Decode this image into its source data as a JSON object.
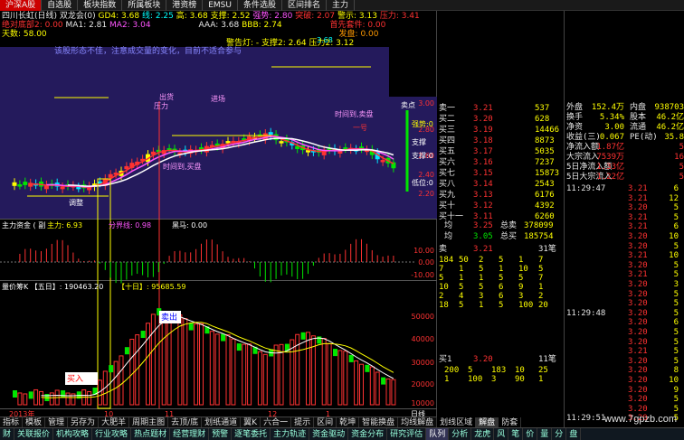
{
  "topbar": {
    "items": [
      "沪深A股",
      "自选股",
      "板块指数",
      "所属板块",
      "港资榜",
      "EMSU",
      "条件选股",
      "区间排名",
      "主力"
    ]
  },
  "chart": {
    "title": "四川长虹(日线) 双龙会(0)",
    "header_vals": [
      "GD4: 3.68",
      "线: 2.25",
      "高: 3.68",
      "支撑: 2.52",
      "强势: 2.80",
      "突破: 2.07",
      "警示: 3.13",
      "压力: 3.41",
      "压力"
    ],
    "line2_label": "绝对底部2: 0.00",
    "line2_ma": [
      "MA1: 2.81",
      "MA2: 3.04"
    ],
    "line2_extra": [
      "AAA: 3.68",
      "BBB: 2.74"
    ],
    "line2_right": "首先套件: 0.00",
    "line3": [
      "天数: 58.00",
      "发盘: 0.00"
    ],
    "line4_right": "警告灯: -  支撑2: 2.64  压力2: 3.12",
    "top_annotation": "该股形态不佳，注意成交量的变化，目前不适合参与",
    "price_high": "3.68",
    "annotations": [
      "时间到,买盘",
      "时间到,卖盘",
      "出货",
      "进场",
      "一号",
      "调整",
      "压力",
      "支撑",
      "卖点",
      "支撑:0",
      "低位:0",
      "强势:0"
    ],
    "price_axis": [
      "3.00",
      "2.80",
      "2.60",
      "2.40",
      "2.20"
    ],
    "sub1_title": "主力资金 ( 副",
    "sub1_val": "主力: 6.93",
    "sub1_val2": "分界线: 0.98",
    "sub1_val3": "黑马: 0.00",
    "sub1_axis": [
      "10.00",
      "0.00",
      "-10.00"
    ],
    "sub2_title": "量价筹K 【五日】: 190463.20",
    "sub2_ten": "【十日】: 95685.59",
    "sub2_axis": [
      "50000",
      "40000",
      "30000",
      "20000",
      "10000"
    ],
    "sub2_labels": [
      "买入",
      "卖出"
    ],
    "x_labels": [
      "2013年",
      "10",
      "11",
      "12",
      "1"
    ],
    "day_unit": "日线"
  },
  "quote": {
    "sells": [
      {
        "label": "卖一",
        "price": "3.21",
        "vol": "537"
      },
      {
        "label": "买二",
        "price": "3.20",
        "vol": "628"
      },
      {
        "label": "买三",
        "price": "3.19",
        "vol": "14466"
      },
      {
        "label": "买四",
        "price": "3.18",
        "vol": "8873"
      },
      {
        "label": "买五",
        "price": "3.17",
        "vol": "5035"
      },
      {
        "label": "买六",
        "price": "3.16",
        "vol": "7237"
      },
      {
        "label": "买七",
        "price": "3.15",
        "vol": "15873"
      },
      {
        "label": "买八",
        "price": "3.14",
        "vol": "2543"
      },
      {
        "label": "买九",
        "price": "3.13",
        "vol": "6176"
      },
      {
        "label": "买十",
        "price": "3.12",
        "vol": "4392"
      },
      {
        "label": "买十一",
        "price": "3.11",
        "vol": "6260"
      }
    ],
    "summary1": {
      "label": "均",
      "price": "3.25",
      "text": "总卖",
      "val": "378099"
    },
    "summary2": {
      "label": "均",
      "price": "3.05",
      "text": "总买",
      "val": "185754"
    },
    "sell_queue_head": {
      "label": "卖",
      "price": "3.21",
      "count": "31笔"
    },
    "sell_queue": [
      [
        "184",
        "50",
        "2",
        "5",
        "1",
        "7"
      ],
      [
        "7",
        "1",
        "5",
        "1",
        "10",
        "5"
      ],
      [
        "5",
        "1",
        "1",
        "5",
        "5",
        "7"
      ],
      [
        "10",
        "5",
        "5",
        "6",
        "9",
        "1"
      ],
      [
        "2",
        "4",
        "3",
        "6",
        "3",
        "2"
      ],
      [
        "18",
        "5",
        "1",
        "5",
        "100",
        "20"
      ]
    ],
    "buy_queue_head": {
      "label": "买1",
      "price": "3.20",
      "count": "11笔"
    },
    "buy_queue": [
      [
        "200",
        "5",
        "183",
        "10",
        "25"
      ],
      [
        "1",
        "100",
        "3",
        "90",
        "1"
      ]
    ]
  },
  "stats": {
    "rows": [
      {
        "l": "外盘",
        "v": "152.4万",
        "l2": "内盘",
        "v2": "938703"
      },
      {
        "l": "换手",
        "v": "5.34%",
        "l2": "股本",
        "v2": "46.2亿"
      },
      {
        "l": "净资",
        "v": "3.00",
        "l2": "流通",
        "v2": "46.2亿"
      },
      {
        "l": "收益(三)",
        "v": "0.067",
        "l2": "PE(动)",
        "v2": "35.8"
      },
      {
        "l": "净流入额",
        "v": "1.87亿",
        "l2": "",
        "v2": "5"
      },
      {
        "l": "大宗流入",
        "v": "7539万",
        "l2": "",
        "v2": "16"
      },
      {
        "l": "5日净流入额",
        "v": "1.33亿",
        "l2": "",
        "v2": "5"
      },
      {
        "l": "5日大宗流入",
        "v": "1.22亿",
        "l2": "",
        "v2": "5"
      }
    ],
    "ticks": [
      {
        "t": "11:29:47",
        "p": "3.21",
        "v": "6"
      },
      {
        "t": "",
        "p": "3.21",
        "v": "12"
      },
      {
        "t": "",
        "p": "3.20",
        "v": "5"
      },
      {
        "t": "",
        "p": "3.21",
        "v": "5"
      },
      {
        "t": "",
        "p": "3.21",
        "v": "6"
      },
      {
        "t": "",
        "p": "3.20",
        "v": "10"
      },
      {
        "t": "",
        "p": "3.20",
        "v": "5"
      },
      {
        "t": "",
        "p": "3.21",
        "v": "10"
      },
      {
        "t": "",
        "p": "3.20",
        "v": "5"
      },
      {
        "t": "",
        "p": "3.21",
        "v": "5"
      },
      {
        "t": "",
        "p": "3.20",
        "v": "3"
      },
      {
        "t": "",
        "p": "3.20",
        "v": "5"
      },
      {
        "t": "",
        "p": "3.20",
        "v": "5"
      },
      {
        "t": "11:29:48",
        "p": "3.20",
        "v": "5"
      },
      {
        "t": "",
        "p": "3.20",
        "v": "6"
      },
      {
        "t": "",
        "p": "3.20",
        "v": "5"
      },
      {
        "t": "",
        "p": "3.20",
        "v": "5"
      },
      {
        "t": "",
        "p": "3.21",
        "v": "5"
      },
      {
        "t": "",
        "p": "3.20",
        "v": "5"
      },
      {
        "t": "",
        "p": "3.20",
        "v": "8"
      },
      {
        "t": "",
        "p": "3.20",
        "v": "10"
      },
      {
        "t": "",
        "p": "3.20",
        "v": "9"
      },
      {
        "t": "",
        "p": "3.20",
        "v": "5"
      },
      {
        "t": "",
        "p": "3.20",
        "v": "5"
      },
      {
        "t": "11:29:51",
        "p": "3.20",
        "v": "5"
      }
    ]
  },
  "tabs1": [
    "指标",
    "模板",
    "管理",
    "另存为",
    "大肥羊",
    "周期主图",
    "去顶/底",
    "划纸通道",
    "翼K",
    "六合一",
    "提示",
    "区间",
    "乾坤",
    "智能换盘",
    "均线解盘",
    "划线区域",
    "解盘",
    "防套"
  ],
  "tabs1_active": "解盘",
  "tabs2": [
    "财",
    "关联报价",
    "机构攻略",
    "行业攻略",
    "热点题材",
    "经营理财",
    "预警",
    "逐笔委托",
    "主力轨迹",
    "资金驱动",
    "资金分布",
    "研究评估",
    "队列",
    "分析",
    "龙虎",
    "风"
  ],
  "tabs2_right": [
    "笔",
    "价",
    "量",
    "分",
    "盘"
  ],
  "watermark": "www.7gpzb.com",
  "colors": {
    "up": "#ff3232",
    "down": "#00e600",
    "bg_top": "#2a1a6a",
    "accent": "#ffff00"
  }
}
